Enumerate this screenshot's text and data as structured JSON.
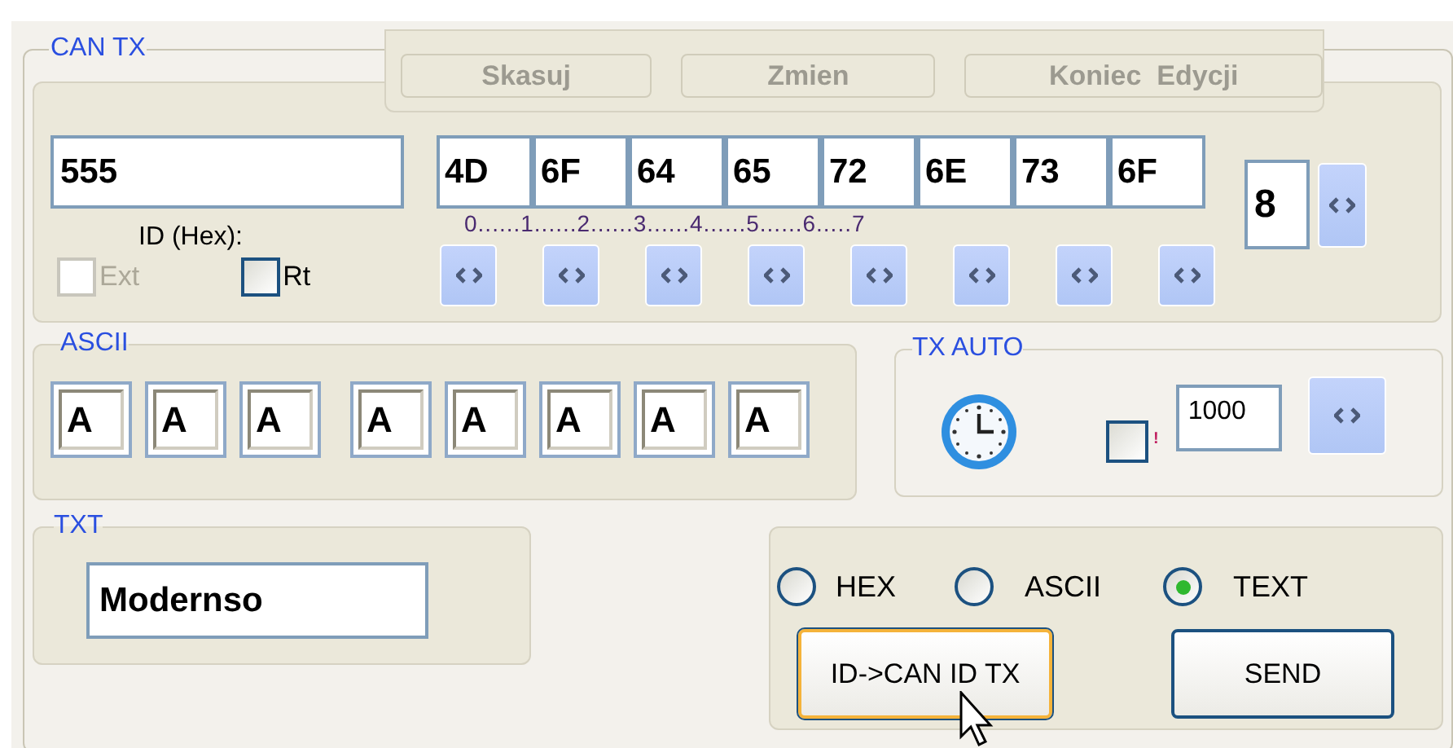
{
  "group": {
    "title": "CAN TX"
  },
  "edit_buttons": [
    {
      "label": "Skasuj",
      "disabled": true
    },
    {
      "label": "Zmien",
      "disabled": true
    },
    {
      "label": "Koniec  Edycji",
      "disabled": true
    }
  ],
  "id_field": {
    "value": "555",
    "label": "ID (Hex):"
  },
  "ext": {
    "label": "Ext",
    "checked": false,
    "disabled": true
  },
  "rt": {
    "label": "Rt",
    "checked": false,
    "disabled": false
  },
  "data_bytes": [
    "4D",
    "6F",
    "64",
    "65",
    "72",
    "6E",
    "73",
    "6F"
  ],
  "byte_index": "0......1......2......3......4......5......6.....7",
  "dlc": "8",
  "ascii": {
    "title": "ASCII",
    "chars": [
      "A",
      "A",
      "A",
      "A",
      "A",
      "A",
      "A",
      "A"
    ]
  },
  "tx_auto": {
    "title": "TX AUTO",
    "checked": false,
    "mark": "!",
    "interval": "1000"
  },
  "txt": {
    "title": "TXT",
    "value": "Modernso"
  },
  "format": [
    {
      "label": "HEX",
      "selected": false
    },
    {
      "label": "ASCII",
      "selected": false
    },
    {
      "label": "TEXT",
      "selected": true
    }
  ],
  "buttons": [
    {
      "label": "ID->CAN ID TX",
      "focused": true
    },
    {
      "label": "SEND",
      "focused": false
    }
  ]
}
